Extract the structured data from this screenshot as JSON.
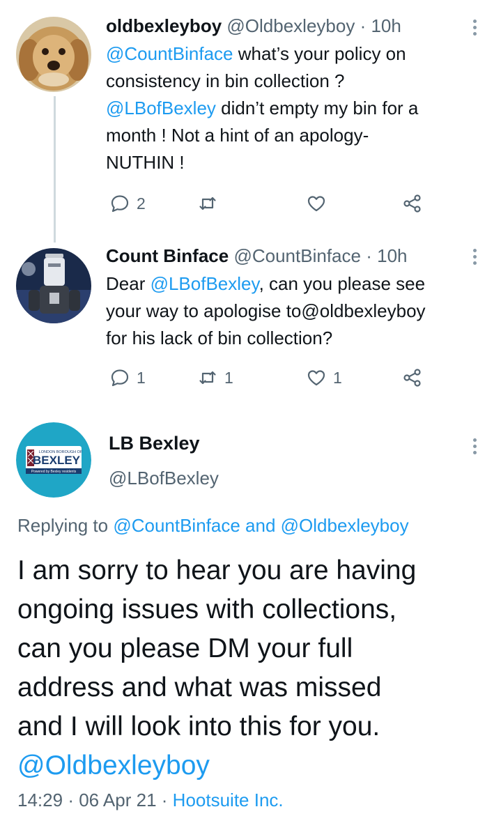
{
  "tweets": [
    {
      "name": "oldbexleyboy",
      "handle": "@Oldbexleyboy",
      "separator": "·",
      "time": "10h",
      "lines": [
        [
          {
            "t": "@CountBinface",
            "m": true
          },
          {
            "t": " what’s your policy on",
            "m": false
          }
        ],
        [
          {
            "t": "consistency in bin collection ?",
            "m": false
          }
        ],
        [
          {
            "t": "@LBofBexley",
            "m": true
          },
          {
            "t": " didn’t empty my bin for a",
            "m": false
          }
        ],
        [
          {
            "t": "month !  Not a hint of an apology-",
            "m": false
          }
        ],
        [
          {
            "t": "NUTHIN !",
            "m": false
          }
        ]
      ],
      "reply_count": "2",
      "retweet_count": "",
      "like_count": ""
    },
    {
      "name": "Count Binface",
      "handle": "@CountBinface",
      "separator": "·",
      "time": "10h",
      "lines": [
        [
          {
            "t": "Dear ",
            "m": false
          },
          {
            "t": "@LBofBexley",
            "m": true
          },
          {
            "t": ", can you please see",
            "m": false
          }
        ],
        [
          {
            "t": "your way to apologise to@oldbexleyboy",
            "m": false
          }
        ],
        [
          {
            "t": "for his lack of bin collection?",
            "m": false
          }
        ]
      ],
      "reply_count": "1",
      "retweet_count": "1",
      "like_count": "1"
    }
  ],
  "main_tweet": {
    "name": "LB Bexley",
    "handle": "@LBofBexley",
    "avatar": {
      "top_text": "LONDON BOROUGH OF",
      "word": "BEXLEY",
      "tagline": "Powered by Bexley residents",
      "bg": "#1fa6c6"
    },
    "replying_prefix": "Replying to ",
    "replying_user1": "@CountBinface",
    "replying_and": " and ",
    "replying_user2": "@Oldbexleyboy",
    "lines": [
      "I am sorry to hear you are having",
      "ongoing issues with collections,",
      "can you please DM your full",
      "address and what was missed",
      "and I will look into this for you."
    ],
    "mention_line": "@Oldbexleyboy",
    "time": "14:29",
    "sep1": "·",
    "date": "06 Apr 21",
    "sep2": "·",
    "source": "Hootsuite Inc."
  },
  "colors": {
    "link": "#1d9bf0",
    "secondary": "#536471",
    "text": "#0f1419",
    "thread_line": "#cfd9de"
  },
  "icons": [
    "reply-icon",
    "retweet-icon",
    "like-icon",
    "share-icon",
    "more-options-icon"
  ]
}
